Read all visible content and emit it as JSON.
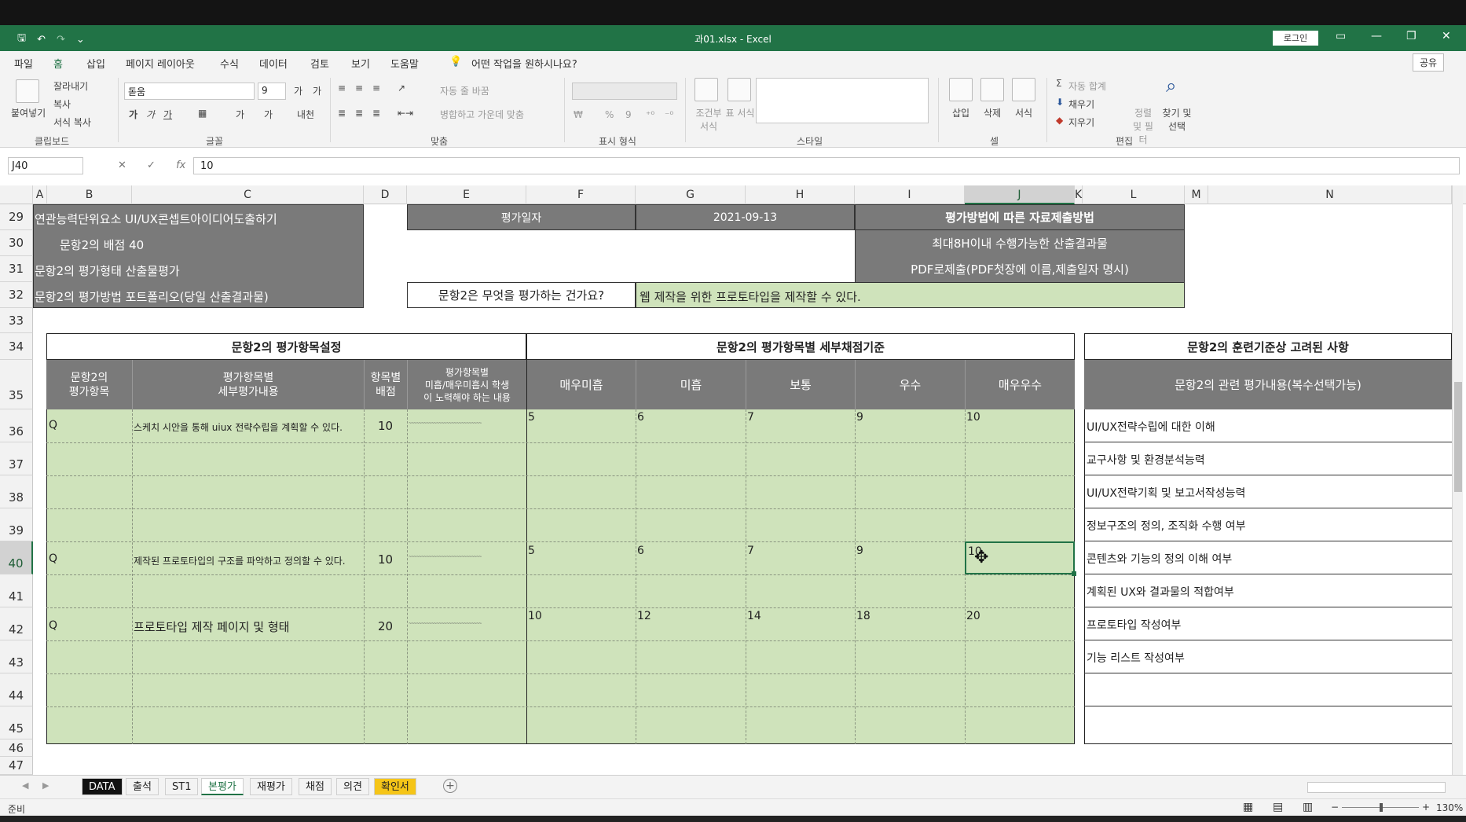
{
  "titlebar": {
    "qat": {
      "save_icon": "save-icon",
      "undo_icon": "undo-icon",
      "redo_icon": "redo-icon",
      "more": "⌄"
    },
    "title": "과01.xlsx  -  Excel",
    "login": "로그인",
    "buttons": {
      "ribbon_display": "▭",
      "minimize": "—",
      "restore": "❐",
      "close": "✕"
    }
  },
  "menu": {
    "tabs": [
      "파일",
      "홈",
      "삽입",
      "페이지 레이아웃",
      "수식",
      "데이터",
      "검토",
      "보기",
      "도움말"
    ],
    "active": "홈",
    "tell_me": "어떤 작업을 원하시나요?",
    "share": "공유"
  },
  "ribbon": {
    "clipboard": {
      "paste": "붙여넣기",
      "cut": "잘라내기",
      "copy": "복사",
      "format_painter": "서식 복사",
      "label": "클립보드"
    },
    "font": {
      "name": "돋움",
      "size": "9",
      "grow": "가",
      "shrink": "가",
      "bold": "가",
      "italic": "가",
      "underline": "가",
      "fill": "가",
      "color": "가",
      "phonetic": "내천",
      "label": "글꼴"
    },
    "alignment": {
      "wrap": "자동 줄 바꿈",
      "merge": "병합하고 가운데 맞춤",
      "label": "맞춤"
    },
    "number": {
      "format": "",
      "percent": "%",
      "comma": "9",
      "label": "표시 형식"
    },
    "styles": {
      "conditional": "조건부 서식",
      "table": "표 서식",
      "label": "스타일"
    },
    "cells": {
      "insert": "삽입",
      "delete": "삭제",
      "format": "서식",
      "label": "셀"
    },
    "editing": {
      "autosum": "자동 합계",
      "fill": "채우기",
      "clear": "지우기",
      "sort": "정렬 및 필터",
      "find": "찾기 및 선택",
      "label": "편집"
    }
  },
  "formula_bar": {
    "name_box": "J40",
    "cancel": "✕",
    "enter": "✓",
    "fx": "fx",
    "value": "10"
  },
  "columns": [
    "A",
    "B",
    "C",
    "D",
    "E",
    "F",
    "G",
    "H",
    "I",
    "J",
    "K",
    "L",
    "M",
    "N"
  ],
  "rows": [
    "29",
    "30",
    "31",
    "32",
    "33",
    "34",
    "35",
    "36",
    "37",
    "38",
    "39",
    "40",
    "41",
    "42",
    "43",
    "44",
    "45",
    "46",
    "47"
  ],
  "sheet": {
    "r29_a": "연관능력단위요소 UI/UX콘셉트아이디어도출하기",
    "r30_a": "문항2의 배점 40",
    "r31_a": "문항2의 평가형태 산출물평가",
    "r32_a": "문항2의 평가방법 포트폴리오(당일 산출결과물)",
    "eval_date_label": "평가일자",
    "eval_date": "2021-09-13",
    "submit_method_title": "평가방법에 따른 자료제출방법",
    "submit_line1": "최대8H이내 수행가능한 산출결과물",
    "submit_line2": "PDF로제출(PDF첫장에 이름,제출일자 명시)",
    "q_label": "문항2은 무엇을 평가하는 건가요?",
    "q_answer": "웹 제작을 위한 프로토타입을 제작할 수 있다.",
    "sec1_title": "문항2의 평가항목설정",
    "sec2_title": "문항2의 평가항목별 세부채점기준",
    "sec3_title": "문항2의 훈련기준상 고려된 사항",
    "hdr_item": "문항2의\n평가항목",
    "hdr_detail": "평가항목별\n세부평가내용",
    "hdr_score": "항목별\n배점",
    "hdr_effort": "평가항목별\n미흡/매우미흡시 학생\n이 노력해야 하는 내용",
    "grade_vlow": "매우미흡",
    "grade_low": "미흡",
    "grade_mid": "보통",
    "grade_good": "우수",
    "grade_best": "매우우수",
    "hdr_related": "문항2의 관련 평가내용(복수선택가능)",
    "r36_q": "Q",
    "r36_detail": "스케치 시안을 통해 uiux 전략수립을 계획할 수 있다.",
    "r36_score": "10",
    "r36_effort": "~~~~~~~~~~~~~~~~~~~~~~~~~~~~~",
    "r36_g1": "5",
    "r36_g2": "6",
    "r36_g3": "7",
    "r36_g4": "9",
    "r36_g5": "10",
    "r40_q": "Q",
    "r40_detail": "제작된 프로토타입의 구조를 파악하고 정의할 수 있다.",
    "r40_score": "10",
    "r40_effort": "~~~~~~~~~~~~~~~~~~~~~~~~~~~~~",
    "r40_g1": "5",
    "r40_g2": "6",
    "r40_g3": "7",
    "r40_g4": "9",
    "r40_g5": "10",
    "r42_q": "Q",
    "r42_detail": "프로토타입 제작 페이지 및 형태",
    "r42_score": "20",
    "r42_effort": "~~~~~~~~~~~~~~~~~~~~~~~~~~~~~",
    "r42_g1": "10",
    "r42_g2": "12",
    "r42_g3": "14",
    "r42_g4": "18",
    "r42_g5": "20",
    "related": [
      "UI/UX전략수립에 대한 이해",
      "교구사항 및 환경분석능력",
      "UI/UX전략기획 및 보고서작성능력",
      "정보구조의 정의, 조직화 수행 여부",
      "콘텐츠와 기능의 정의 이해 여부",
      "계획된 UX와 결과물의 적합여부",
      "프로토타입 작성여부",
      "기능 리스트 작성여부"
    ]
  },
  "sheet_tabs": [
    "DATA",
    "출석",
    "ST1",
    "본평가",
    "재평가",
    "채점",
    "의견",
    "확인서"
  ],
  "active_sheet": "본평가",
  "status": {
    "ready": "준비",
    "zoom": "130%"
  },
  "colors": {
    "excel_green": "#217346",
    "dark_fill": "#7a7a7a",
    "green_fill": "#cfe3bb"
  }
}
